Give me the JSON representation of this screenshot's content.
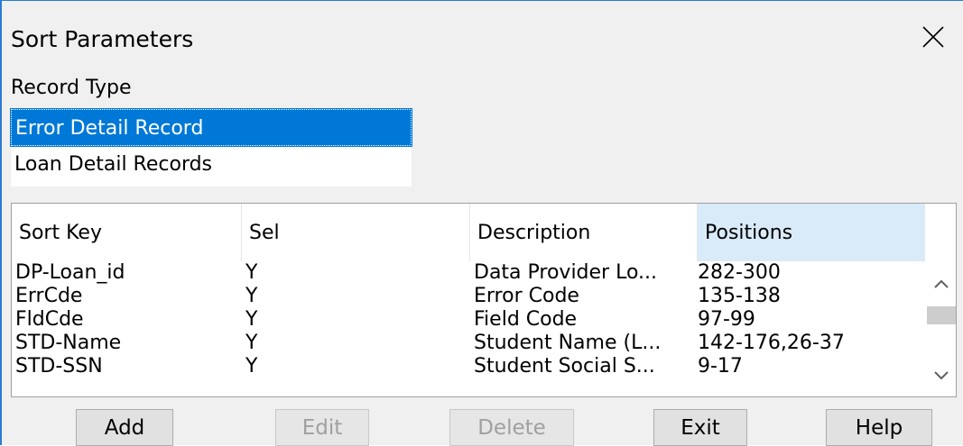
{
  "window": {
    "title": "Sort Parameters"
  },
  "record_type": {
    "label": "Record Type",
    "items": [
      {
        "label": "Error Detail Record",
        "selected": true
      },
      {
        "label": "Loan Detail Records",
        "selected": false
      }
    ]
  },
  "grid": {
    "columns": [
      "Sort Key",
      "Sel",
      "Description",
      "Positions"
    ],
    "rows": [
      {
        "key": "DP-Loan_id",
        "sel": "Y",
        "desc": "Data Provider Lo...",
        "pos": "282-300"
      },
      {
        "key": "ErrCde",
        "sel": "Y",
        "desc": "Error Code",
        "pos": "135-138"
      },
      {
        "key": "FldCde",
        "sel": "Y",
        "desc": "Field Code",
        "pos": "97-99"
      },
      {
        "key": "STD-Name",
        "sel": "Y",
        "desc": "Student Name (L...",
        "pos": "142-176,26-37"
      },
      {
        "key": "STD-SSN",
        "sel": "Y",
        "desc": "Student Social S...",
        "pos": "9-17"
      }
    ]
  },
  "buttons": {
    "add": "Add",
    "edit": "Edit",
    "delete": "Delete",
    "exit": "Exit",
    "help": "Help"
  },
  "colors": {
    "selection": "#0078d7",
    "active_header": "#d9ebf9",
    "window_border": "#2b7bd6"
  },
  "icons": {
    "close": "close-icon",
    "scroll_up": "chevron-up-icon",
    "scroll_down": "chevron-down-icon"
  }
}
